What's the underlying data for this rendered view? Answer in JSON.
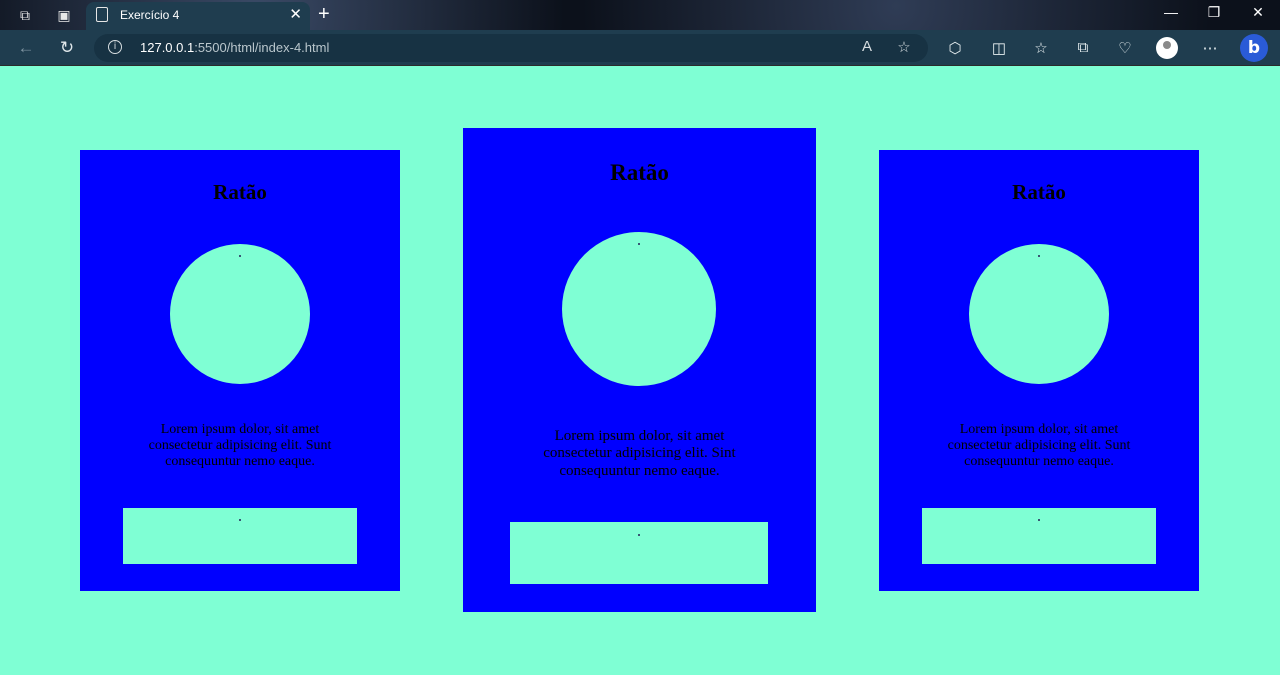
{
  "browser": {
    "tab_title": "Exercício 4",
    "url_host": "127.0.0.1",
    "url_rest": ":5500/html/index-4.html",
    "bing_label": "b"
  },
  "cards": [
    {
      "title": "Ratão",
      "text": "Lorem ipsum dolor, sit amet consectetur adipisicing elit. Sunt consequuntur nemo eaque."
    },
    {
      "title": "Ratão",
      "text": "Lorem ipsum dolor, sit amet consectetur adipisicing elit. Sint consequuntur nemo eaque."
    },
    {
      "title": "Ratão",
      "text": "Lorem ipsum dolor, sit amet consectetur adipisicing elit. Sunt consequuntur nemo eaque."
    }
  ],
  "colors": {
    "page_background": "#7fffd4",
    "card_background": "#0000ff",
    "browser_toolbar": "#1f3d4f"
  },
  "icons": {
    "workspaces": "workspaces-icon",
    "tab_actions": "tab-actions-icon",
    "page": "page-icon",
    "close_tab": "close-icon",
    "new_tab": "plus-icon",
    "back": "back-arrow-icon",
    "reload": "reload-icon",
    "info": "info-icon",
    "read_aloud": "read-aloud-icon",
    "favorite": "star-icon",
    "extensions": "puzzle-icon",
    "split_screen": "split-screen-icon",
    "favorites": "favorites-icon",
    "collections": "collections-icon",
    "performance": "heart-icon",
    "profile": "profile-icon",
    "more": "more-icon",
    "copilot": "bing-icon"
  }
}
